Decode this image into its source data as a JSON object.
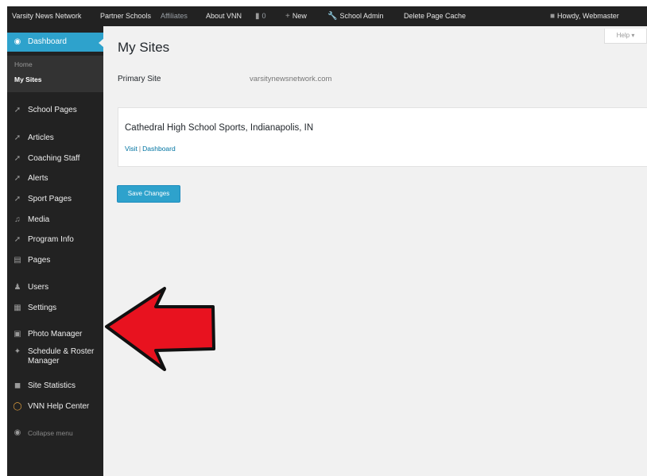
{
  "adminbar": {
    "site": "Varsity News Network",
    "partner": "Partner Schools",
    "affiliates": "Affiliates",
    "about": "About VNN",
    "comments_count": "0",
    "new": "New",
    "school_admin": "School Admin",
    "delete_cache": "Delete Page Cache",
    "howdy": "Howdy, Webmaster",
    "icons": {
      "comment": "comment-icon",
      "plus": "plus-icon",
      "wrench": "wrench-icon",
      "avatar": "avatar-icon"
    }
  },
  "sidebar": {
    "dashboard": "Dashboard",
    "submenu": {
      "home": "Home",
      "my_sites": "My Sites"
    },
    "items": [
      {
        "label": "School Pages",
        "icon": "pin-icon"
      },
      {
        "label": "Articles",
        "icon": "pin-icon"
      },
      {
        "label": "Coaching Staff",
        "icon": "pin-icon"
      },
      {
        "label": "Alerts",
        "icon": "pin-icon"
      },
      {
        "label": "Sport Pages",
        "icon": "pin-icon"
      },
      {
        "label": "Media",
        "icon": "media-icon"
      },
      {
        "label": "Program Info",
        "icon": "pin-icon"
      },
      {
        "label": "Pages",
        "icon": "page-icon"
      },
      {
        "label": "Users",
        "icon": "user-icon"
      },
      {
        "label": "Settings",
        "icon": "settings-icon"
      },
      {
        "label": "Photo Manager",
        "icon": "photo-icon"
      },
      {
        "label": "Schedule & Roster",
        "label2": "Manager",
        "icon": "puzzle-icon"
      },
      {
        "label": "Site Statistics",
        "icon": "stats-icon"
      },
      {
        "label": "VNN Help Center",
        "icon": "lifebuoy-icon"
      }
    ],
    "collapse": "Collapse menu"
  },
  "help": "Help",
  "main": {
    "title": "My Sites",
    "primary_label": "Primary Site",
    "primary_value": "varsitynewsnetwork.com",
    "site_card": {
      "name": "Cathedral High School Sports, Indianapolis, IN",
      "visit": "Visit",
      "sep": "|",
      "dashboard": "Dashboard"
    },
    "save": "Save Changes"
  },
  "colors": {
    "accent": "#2ea2cc",
    "sidebar": "#222222",
    "arrow": "#e8121f"
  }
}
